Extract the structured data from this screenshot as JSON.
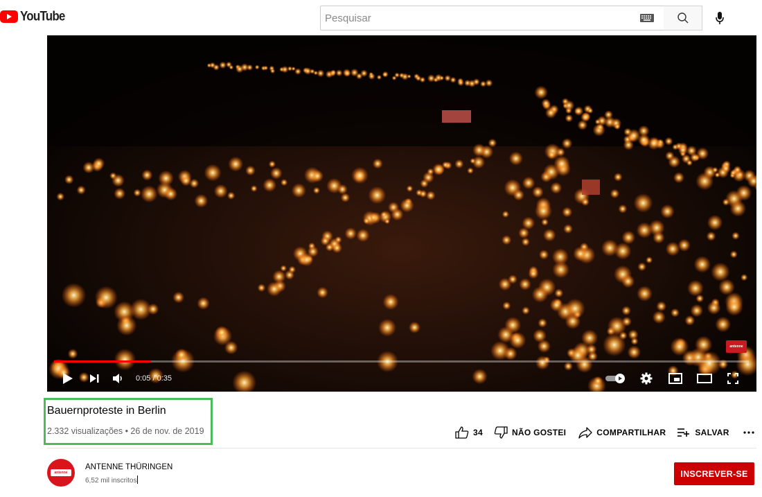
{
  "header": {
    "logo_text": "YouTube",
    "search_placeholder": "Pesquisar"
  },
  "player": {
    "time": "0:05 / 0:35",
    "progress_fraction": 0.14,
    "watermark_text": "antenne"
  },
  "video": {
    "title": "Bauernproteste in Berlin",
    "meta": "2.332 visualizações • 26 de nov. de 2019"
  },
  "actions": {
    "like_count": "34",
    "dislike_label": "NÃO GOSTEI",
    "share_label": "COMPARTILHAR",
    "save_label": "SALVAR"
  },
  "channel": {
    "name": "ANTENNE THÜRINGEN",
    "subscribers": "6,52 mil inscritos",
    "avatar_text": "antenne",
    "subscribe_label": "INSCREVER-SE"
  },
  "colors": {
    "brand_red": "#ff0000",
    "subscribe_red": "#cc0000",
    "highlight_green": "#4cbb5a"
  }
}
